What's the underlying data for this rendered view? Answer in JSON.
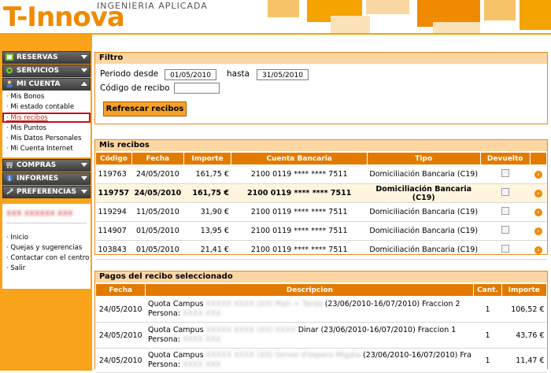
{
  "header": {
    "logo_text_main": "T-Innova",
    "logo_subtitle": "INGENIERIA APLICADA"
  },
  "sidebar": {
    "menus": {
      "reservas": "RESERVAS",
      "servicios": "SERVICIOS",
      "mi_cuenta": "MI CUENTA",
      "compras": "COMPRAS",
      "informes": "INFORMES",
      "preferencias": "PREFERENCIAS"
    },
    "mi_cuenta_items": [
      "Mis Bonos",
      "Mi estado contable",
      "Mis recibos",
      "Mis Puntos",
      "Mis Datos Personales",
      "Mi Cuenta Internet"
    ],
    "user_name_blurred": "XXX XXXXXX XXX",
    "user_links": [
      "Inicio",
      "Quejas y sugerencias",
      "Contactar con el centro",
      "Salir"
    ]
  },
  "filtro": {
    "title": "Filtro",
    "periodo_desde_label": "Periodo desde",
    "periodo_desde_value": "01/05/2010",
    "hasta_label": "hasta",
    "hasta_value": "31/05/2010",
    "codigo_label": "Código de recibo",
    "codigo_value": "",
    "refresh_button": "Refrescar recibos"
  },
  "recibos": {
    "title": "Mis recibos",
    "columns": [
      "Código",
      "Fecha",
      "Importe",
      "Cuenta Bancaria",
      "Tipo",
      "Devuelto"
    ],
    "rows": [
      {
        "codigo": "119763",
        "fecha": "24/05/2010",
        "importe": "161,75 €",
        "cuenta": "2100 0119 **** **** 7511",
        "tipo": "Domiciliación Bancaria (C19)"
      },
      {
        "codigo": "119757",
        "fecha": "24/05/2010",
        "importe": "161,75 €",
        "cuenta": "2100 0119 **** **** 7511",
        "tipo": "Domiciliación Bancaria (C19)"
      },
      {
        "codigo": "119294",
        "fecha": "11/05/2010",
        "importe": "31,90 €",
        "cuenta": "2100 0119 **** **** 7511",
        "tipo": "Domiciliación Bancaria (C19)"
      },
      {
        "codigo": "114907",
        "fecha": "01/05/2010",
        "importe": "13,95 €",
        "cuenta": "2100 0119 **** **** 7511",
        "tipo": "Domiciliación Bancaria (C19)"
      },
      {
        "codigo": "103843",
        "fecha": "01/05/2010",
        "importe": "21,41 €",
        "cuenta": "2100 0119 **** **** 7511",
        "tipo": "Domiciliación Bancaria (C19)"
      }
    ]
  },
  "pagos": {
    "title": "Pagos del recibo seleccionado",
    "columns": [
      "Fecha",
      "Descripcion",
      "Cant.",
      "Importe"
    ],
    "rows": [
      {
        "fecha": "24/05/2010",
        "desc_a": "Quota Campus",
        "desc_blur": "XXXXX XXXX (XX) Mati + Tarda",
        "desc_b": "(23/06/2010-16/07/2010) Fraccion 2",
        "persona_label": "Persona:",
        "persona_blur": "XXXX XXX",
        "cant": "1",
        "importe": "106,52 €"
      },
      {
        "fecha": "24/05/2010",
        "desc_a": "Quota Campus",
        "desc_blur": "XXXXX XXXX (XX) XXXX",
        "desc_b": "Dinar (23/06/2010-16/07/2010) Fraccion 1",
        "persona_label": "Persona:",
        "persona_blur": "XXXX XXX",
        "cant": "1",
        "importe": "43,76 €"
      },
      {
        "fecha": "24/05/2010",
        "desc_a": "Quota Campus",
        "desc_blur": "XXXXX XXXX (XX) Servei d'espera Migdia",
        "desc_b": "(23/06/2010-16/07/2010) Fra",
        "persona_label": "Persona:",
        "persona_blur": "XXXX XXX",
        "cant": "1",
        "importe": "11,47 €"
      }
    ]
  },
  "colors": {
    "accent_orange": "#e37a00",
    "sidebar_orange": "#f9a31a",
    "panel_title_bg": "#fcd6a3",
    "menu_head_dark": "#4a4a4a",
    "selected_highlight": "#c1121c"
  },
  "icons": [
    "grid-icon",
    "gear-icon",
    "person-icon",
    "cart-icon",
    "info-icon",
    "wrench-icon",
    "go-arrow-icon",
    "chevron-down-icon",
    "chevron-up-icon"
  ]
}
